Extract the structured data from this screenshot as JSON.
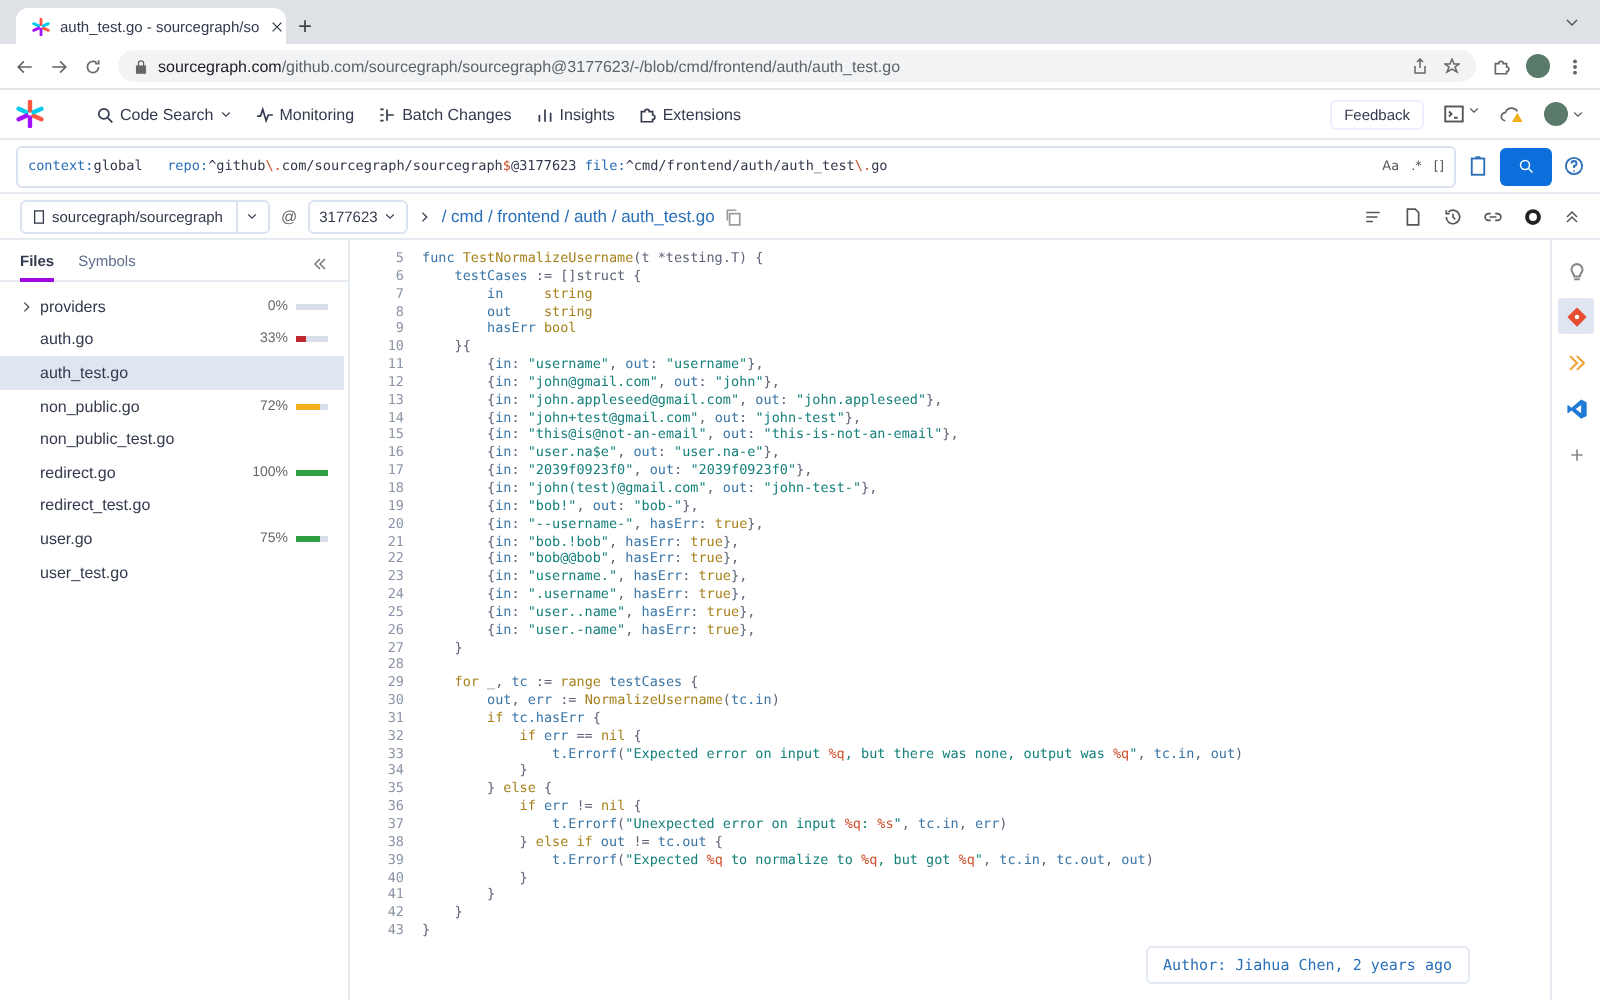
{
  "browser": {
    "tab_title": "auth_test.go - sourcegraph/so",
    "new_tab": "+",
    "url_host": "sourcegraph.com",
    "url_path": "/github.com/sourcegraph/sourcegraph@3177623/-/blob/cmd/frontend/auth/auth_test.go"
  },
  "nav": {
    "items": [
      {
        "label": "Code Search",
        "dropdown": true
      },
      {
        "label": "Monitoring",
        "dropdown": false
      },
      {
        "label": "Batch Changes",
        "dropdown": false
      },
      {
        "label": "Insights",
        "dropdown": false
      },
      {
        "label": "Extensions",
        "dropdown": false
      }
    ],
    "feedback": "Feedback"
  },
  "search": {
    "query": [
      {
        "kind": "filter",
        "text": "context:"
      },
      {
        "kind": "plain",
        "text": "global   "
      },
      {
        "kind": "filter",
        "text": "repo:"
      },
      {
        "kind": "plain",
        "text": "^github"
      },
      {
        "kind": "escape",
        "text": "\\."
      },
      {
        "kind": "plain",
        "text": "com/sourcegraph/sourcegraph"
      },
      {
        "kind": "escape",
        "text": "$"
      },
      {
        "kind": "plain",
        "text": "@3177623 "
      },
      {
        "kind": "filter",
        "text": "file:"
      },
      {
        "kind": "plain",
        "text": "^cmd/frontend/auth/auth_test"
      },
      {
        "kind": "escape",
        "text": "\\."
      },
      {
        "kind": "plain",
        "text": "go"
      }
    ],
    "toggles": [
      "Aa",
      ".*",
      "[]"
    ]
  },
  "breadcrumb": {
    "repo": "sourcegraph/sourcegraph",
    "at": "@",
    "revision": "3177623",
    "path": "/ cmd / frontend / auth / auth_test.go"
  },
  "sidebar": {
    "tabs": [
      {
        "label": "Files",
        "selected": true
      },
      {
        "label": "Symbols",
        "selected": false
      }
    ],
    "files": [
      {
        "kind": "folder",
        "name": "providers",
        "expanded": false,
        "coverage": "0%",
        "selected": false
      },
      {
        "kind": "file",
        "name": "auth.go",
        "coverage": "33%",
        "level": 0.33,
        "color": "#c0262d",
        "selected": false
      },
      {
        "kind": "file",
        "name": "auth_test.go",
        "selected": true
      },
      {
        "kind": "file",
        "name": "non_public.go",
        "coverage": "72%",
        "level": 0.72,
        "color": "#f2b01e",
        "selected": false
      },
      {
        "kind": "file",
        "name": "non_public_test.go",
        "selected": false
      },
      {
        "kind": "file",
        "name": "redirect.go",
        "coverage": "100%",
        "level": 1,
        "color": "#2ea043",
        "selected": false
      },
      {
        "kind": "file",
        "name": "redirect_test.go",
        "selected": false
      },
      {
        "kind": "file",
        "name": "user.go",
        "coverage": "75%",
        "level": 0.75,
        "color": "#2ea043",
        "selected": false
      },
      {
        "kind": "file",
        "name": "user_test.go",
        "selected": false
      }
    ]
  },
  "code": [
    {
      "number": "5",
      "segments": [
        {
          "kind": "var",
          "text": "func"
        },
        {
          "kind": "func",
          "text": " TestNormalizeUsername"
        },
        {
          "kind": "plain",
          "text": "(t *testing.T) {"
        }
      ]
    },
    {
      "number": "6",
      "segments": [
        {
          "kind": "var",
          "text": "    testCases"
        },
        {
          "kind": "plain",
          "text": " := []struct {"
        }
      ]
    },
    {
      "number": "7",
      "segments": [
        {
          "kind": "var",
          "text": "        in"
        },
        {
          "kind": "keyword",
          "text": "     string"
        }
      ]
    },
    {
      "number": "8",
      "segments": [
        {
          "kind": "var",
          "text": "        out"
        },
        {
          "kind": "keyword",
          "text": "    string"
        }
      ]
    },
    {
      "number": "9",
      "segments": [
        {
          "kind": "var",
          "text": "        hasErr"
        },
        {
          "kind": "keyword",
          "text": " bool"
        }
      ]
    },
    {
      "number": "10",
      "segments": [
        {
          "kind": "plain",
          "text": "    }{"
        }
      ]
    },
    {
      "number": "11",
      "segments": [
        {
          "kind": "plain",
          "text": "        {"
        },
        {
          "kind": "var",
          "text": "in"
        },
        {
          "kind": "plain",
          "text": ": "
        },
        {
          "kind": "string",
          "text": "\"username\""
        },
        {
          "kind": "plain",
          "text": ", "
        },
        {
          "kind": "var",
          "text": "out"
        },
        {
          "kind": "plain",
          "text": ": "
        },
        {
          "kind": "string",
          "text": "\"username\""
        },
        {
          "kind": "plain",
          "text": "},"
        }
      ]
    },
    {
      "number": "12",
      "segments": [
        {
          "kind": "plain",
          "text": "        {"
        },
        {
          "kind": "var",
          "text": "in"
        },
        {
          "kind": "plain",
          "text": ": "
        },
        {
          "kind": "string",
          "text": "\"john@gmail.com\""
        },
        {
          "kind": "plain",
          "text": ", "
        },
        {
          "kind": "var",
          "text": "out"
        },
        {
          "kind": "plain",
          "text": ": "
        },
        {
          "kind": "string",
          "text": "\"john\""
        },
        {
          "kind": "plain",
          "text": "},"
        }
      ]
    },
    {
      "number": "13",
      "segments": [
        {
          "kind": "plain",
          "text": "        {"
        },
        {
          "kind": "var",
          "text": "in"
        },
        {
          "kind": "plain",
          "text": ": "
        },
        {
          "kind": "string",
          "text": "\"john.appleseed@gmail.com\""
        },
        {
          "kind": "plain",
          "text": ", "
        },
        {
          "kind": "var",
          "text": "out"
        },
        {
          "kind": "plain",
          "text": ": "
        },
        {
          "kind": "string",
          "text": "\"john.appleseed\""
        },
        {
          "kind": "plain",
          "text": "},"
        }
      ]
    },
    {
      "number": "14",
      "segments": [
        {
          "kind": "plain",
          "text": "        {"
        },
        {
          "kind": "var",
          "text": "in"
        },
        {
          "kind": "plain",
          "text": ": "
        },
        {
          "kind": "string",
          "text": "\"john+test@gmail.com\""
        },
        {
          "kind": "plain",
          "text": ", "
        },
        {
          "kind": "var",
          "text": "out"
        },
        {
          "kind": "plain",
          "text": ": "
        },
        {
          "kind": "string",
          "text": "\"john-test\""
        },
        {
          "kind": "plain",
          "text": "},"
        }
      ]
    },
    {
      "number": "15",
      "segments": [
        {
          "kind": "plain",
          "text": "        {"
        },
        {
          "kind": "var",
          "text": "in"
        },
        {
          "kind": "plain",
          "text": ": "
        },
        {
          "kind": "string",
          "text": "\"this@is@not-an-email\""
        },
        {
          "kind": "plain",
          "text": ", "
        },
        {
          "kind": "var",
          "text": "out"
        },
        {
          "kind": "plain",
          "text": ": "
        },
        {
          "kind": "string",
          "text": "\"this-is-not-an-email\""
        },
        {
          "kind": "plain",
          "text": "},"
        }
      ]
    },
    {
      "number": "16",
      "segments": [
        {
          "kind": "plain",
          "text": "        {"
        },
        {
          "kind": "var",
          "text": "in"
        },
        {
          "kind": "plain",
          "text": ": "
        },
        {
          "kind": "string",
          "text": "\"user.na$e\""
        },
        {
          "kind": "plain",
          "text": ", "
        },
        {
          "kind": "var",
          "text": "out"
        },
        {
          "kind": "plain",
          "text": ": "
        },
        {
          "kind": "string",
          "text": "\"user.na-e\""
        },
        {
          "kind": "plain",
          "text": "},"
        }
      ]
    },
    {
      "number": "17",
      "segments": [
        {
          "kind": "plain",
          "text": "        {"
        },
        {
          "kind": "var",
          "text": "in"
        },
        {
          "kind": "plain",
          "text": ": "
        },
        {
          "kind": "string",
          "text": "\"2039f0923f0\""
        },
        {
          "kind": "plain",
          "text": ", "
        },
        {
          "kind": "var",
          "text": "out"
        },
        {
          "kind": "plain",
          "text": ": "
        },
        {
          "kind": "string",
          "text": "\"2039f0923f0\""
        },
        {
          "kind": "plain",
          "text": "},"
        }
      ]
    },
    {
      "number": "18",
      "segments": [
        {
          "kind": "plain",
          "text": "        {"
        },
        {
          "kind": "var",
          "text": "in"
        },
        {
          "kind": "plain",
          "text": ": "
        },
        {
          "kind": "string",
          "text": "\"john(test)@gmail.com\""
        },
        {
          "kind": "plain",
          "text": ", "
        },
        {
          "kind": "var",
          "text": "out"
        },
        {
          "kind": "plain",
          "text": ": "
        },
        {
          "kind": "string",
          "text": "\"john-test-\""
        },
        {
          "kind": "plain",
          "text": "},"
        }
      ]
    },
    {
      "number": "19",
      "segments": [
        {
          "kind": "plain",
          "text": "        {"
        },
        {
          "kind": "var",
          "text": "in"
        },
        {
          "kind": "plain",
          "text": ": "
        },
        {
          "kind": "string",
          "text": "\"bob!\""
        },
        {
          "kind": "plain",
          "text": ", "
        },
        {
          "kind": "var",
          "text": "out"
        },
        {
          "kind": "plain",
          "text": ": "
        },
        {
          "kind": "string",
          "text": "\"bob-\""
        },
        {
          "kind": "plain",
          "text": "},"
        }
      ]
    },
    {
      "number": "20",
      "segments": [
        {
          "kind": "plain",
          "text": "        {"
        },
        {
          "kind": "var",
          "text": "in"
        },
        {
          "kind": "plain",
          "text": ": "
        },
        {
          "kind": "string",
          "text": "\"--username-\""
        },
        {
          "kind": "plain",
          "text": ", "
        },
        {
          "kind": "var",
          "text": "hasErr"
        },
        {
          "kind": "plain",
          "text": ": "
        },
        {
          "kind": "keyword",
          "text": "true"
        },
        {
          "kind": "plain",
          "text": "},"
        }
      ]
    },
    {
      "number": "21",
      "segments": [
        {
          "kind": "plain",
          "text": "        {"
        },
        {
          "kind": "var",
          "text": "in"
        },
        {
          "kind": "plain",
          "text": ": "
        },
        {
          "kind": "string",
          "text": "\"bob.!bob\""
        },
        {
          "kind": "plain",
          "text": ", "
        },
        {
          "kind": "var",
          "text": "hasErr"
        },
        {
          "kind": "plain",
          "text": ": "
        },
        {
          "kind": "keyword",
          "text": "true"
        },
        {
          "kind": "plain",
          "text": "},"
        }
      ]
    },
    {
      "number": "22",
      "segments": [
        {
          "kind": "plain",
          "text": "        {"
        },
        {
          "kind": "var",
          "text": "in"
        },
        {
          "kind": "plain",
          "text": ": "
        },
        {
          "kind": "string",
          "text": "\"bob@@bob\""
        },
        {
          "kind": "plain",
          "text": ", "
        },
        {
          "kind": "var",
          "text": "hasErr"
        },
        {
          "kind": "plain",
          "text": ": "
        },
        {
          "kind": "keyword",
          "text": "true"
        },
        {
          "kind": "plain",
          "text": "},"
        }
      ]
    },
    {
      "number": "23",
      "segments": [
        {
          "kind": "plain",
          "text": "        {"
        },
        {
          "kind": "var",
          "text": "in"
        },
        {
          "kind": "plain",
          "text": ": "
        },
        {
          "kind": "string",
          "text": "\"username.\""
        },
        {
          "kind": "plain",
          "text": ", "
        },
        {
          "kind": "var",
          "text": "hasErr"
        },
        {
          "kind": "plain",
          "text": ": "
        },
        {
          "kind": "keyword",
          "text": "true"
        },
        {
          "kind": "plain",
          "text": "},"
        }
      ]
    },
    {
      "number": "24",
      "segments": [
        {
          "kind": "plain",
          "text": "        {"
        },
        {
          "kind": "var",
          "text": "in"
        },
        {
          "kind": "plain",
          "text": ": "
        },
        {
          "kind": "string",
          "text": "\".username\""
        },
        {
          "kind": "plain",
          "text": ", "
        },
        {
          "kind": "var",
          "text": "hasErr"
        },
        {
          "kind": "plain",
          "text": ": "
        },
        {
          "kind": "keyword",
          "text": "true"
        },
        {
          "kind": "plain",
          "text": "},"
        }
      ]
    },
    {
      "number": "25",
      "segments": [
        {
          "kind": "plain",
          "text": "        {"
        },
        {
          "kind": "var",
          "text": "in"
        },
        {
          "kind": "plain",
          "text": ": "
        },
        {
          "kind": "string",
          "text": "\"user..name\""
        },
        {
          "kind": "plain",
          "text": ", "
        },
        {
          "kind": "var",
          "text": "hasErr"
        },
        {
          "kind": "plain",
          "text": ": "
        },
        {
          "kind": "keyword",
          "text": "true"
        },
        {
          "kind": "plain",
          "text": "},"
        }
      ]
    },
    {
      "number": "26",
      "segments": [
        {
          "kind": "plain",
          "text": "        {"
        },
        {
          "kind": "var",
          "text": "in"
        },
        {
          "kind": "plain",
          "text": ": "
        },
        {
          "kind": "string",
          "text": "\"user.-name\""
        },
        {
          "kind": "plain",
          "text": ", "
        },
        {
          "kind": "var",
          "text": "hasErr"
        },
        {
          "kind": "plain",
          "text": ": "
        },
        {
          "kind": "keyword",
          "text": "true"
        },
        {
          "kind": "plain",
          "text": "},"
        }
      ]
    },
    {
      "number": "27",
      "segments": [
        {
          "kind": "plain",
          "text": "    }"
        }
      ]
    },
    {
      "number": "28"
    },
    {
      "number": "29",
      "segments": [
        {
          "kind": "keyword",
          "text": "    for"
        },
        {
          "kind": "plain",
          "text": " _, "
        },
        {
          "kind": "var",
          "text": "tc"
        },
        {
          "kind": "plain",
          "text": " := "
        },
        {
          "kind": "keyword",
          "text": "range"
        },
        {
          "kind": "var",
          "text": " testCases"
        },
        {
          "kind": "plain",
          "text": " {"
        }
      ]
    },
    {
      "number": "30",
      "segments": [
        {
          "kind": "var",
          "text": "        out"
        },
        {
          "kind": "plain",
          "text": ", "
        },
        {
          "kind": "var",
          "text": "err"
        },
        {
          "kind": "plain",
          "text": " := "
        },
        {
          "kind": "func",
          "text": "NormalizeUsername"
        },
        {
          "kind": "plain",
          "text": "("
        },
        {
          "kind": "var",
          "text": "tc.in"
        },
        {
          "kind": "plain",
          "text": ")"
        }
      ]
    },
    {
      "number": "31",
      "segments": [
        {
          "kind": "keyword",
          "text": "        if"
        },
        {
          "kind": "var",
          "text": " tc.hasErr"
        },
        {
          "kind": "plain",
          "text": " {"
        }
      ]
    },
    {
      "number": "32",
      "segments": [
        {
          "kind": "keyword",
          "text": "            if"
        },
        {
          "kind": "var",
          "text": " err"
        },
        {
          "kind": "plain",
          "text": " == "
        },
        {
          "kind": "keyword",
          "text": "nil"
        },
        {
          "kind": "plain",
          "text": " {"
        }
      ]
    },
    {
      "number": "33",
      "segments": [
        {
          "kind": "var",
          "text": "                t.Errorf"
        },
        {
          "kind": "plain",
          "text": "("
        },
        {
          "kind": "string",
          "text": "\"Expected error on input "
        },
        {
          "kind": "verb",
          "text": "%q"
        },
        {
          "kind": "string",
          "text": ", but there was none, output was "
        },
        {
          "kind": "verb",
          "text": "%q"
        },
        {
          "kind": "string",
          "text": "\""
        },
        {
          "kind": "plain",
          "text": ", "
        },
        {
          "kind": "var",
          "text": "tc.in"
        },
        {
          "kind": "plain",
          "text": ", "
        },
        {
          "kind": "var",
          "text": "out"
        },
        {
          "kind": "plain",
          "text": ")"
        }
      ]
    },
    {
      "number": "34",
      "segments": [
        {
          "kind": "plain",
          "text": "            }"
        }
      ]
    },
    {
      "number": "35",
      "segments": [
        {
          "kind": "plain",
          "text": "        } "
        },
        {
          "kind": "keyword",
          "text": "else"
        },
        {
          "kind": "plain",
          "text": " {"
        }
      ]
    },
    {
      "number": "36",
      "segments": [
        {
          "kind": "keyword",
          "text": "            if"
        },
        {
          "kind": "var",
          "text": " err"
        },
        {
          "kind": "plain",
          "text": " != "
        },
        {
          "kind": "keyword",
          "text": "nil"
        },
        {
          "kind": "plain",
          "text": " {"
        }
      ]
    },
    {
      "number": "37",
      "segments": [
        {
          "kind": "var",
          "text": "                t.Errorf"
        },
        {
          "kind": "plain",
          "text": "("
        },
        {
          "kind": "string",
          "text": "\"Unexpected error on input "
        },
        {
          "kind": "verb",
          "text": "%q"
        },
        {
          "kind": "string",
          "text": ": "
        },
        {
          "kind": "verb",
          "text": "%s"
        },
        {
          "kind": "string",
          "text": "\""
        },
        {
          "kind": "plain",
          "text": ", "
        },
        {
          "kind": "var",
          "text": "tc.in"
        },
        {
          "kind": "plain",
          "text": ", "
        },
        {
          "kind": "var",
          "text": "err"
        },
        {
          "kind": "plain",
          "text": ")"
        }
      ]
    },
    {
      "number": "38",
      "segments": [
        {
          "kind": "plain",
          "text": "            } "
        },
        {
          "kind": "keyword",
          "text": "else if"
        },
        {
          "kind": "var",
          "text": " out"
        },
        {
          "kind": "plain",
          "text": " != "
        },
        {
          "kind": "var",
          "text": "tc.out"
        },
        {
          "kind": "plain",
          "text": " {"
        }
      ]
    },
    {
      "number": "39",
      "segments": [
        {
          "kind": "var",
          "text": "                t.Errorf"
        },
        {
          "kind": "plain",
          "text": "("
        },
        {
          "kind": "string",
          "text": "\"Expected "
        },
        {
          "kind": "verb",
          "text": "%q"
        },
        {
          "kind": "string",
          "text": " to normalize to "
        },
        {
          "kind": "verb",
          "text": "%q"
        },
        {
          "kind": "string",
          "text": ", but got "
        },
        {
          "kind": "verb",
          "text": "%q"
        },
        {
          "kind": "string",
          "text": "\""
        },
        {
          "kind": "plain",
          "text": ", "
        },
        {
          "kind": "var",
          "text": "tc.in"
        },
        {
          "kind": "plain",
          "text": ", "
        },
        {
          "kind": "var",
          "text": "tc.out"
        },
        {
          "kind": "plain",
          "text": ", "
        },
        {
          "kind": "var",
          "text": "out"
        },
        {
          "kind": "plain",
          "text": ")"
        }
      ]
    },
    {
      "number": "40",
      "segments": [
        {
          "kind": "plain",
          "text": "            }"
        }
      ]
    },
    {
      "number": "41",
      "segments": [
        {
          "kind": "plain",
          "text": "        }"
        }
      ]
    },
    {
      "number": "42",
      "segments": [
        {
          "kind": "plain",
          "text": "    }"
        }
      ]
    },
    {
      "number": "43",
      "segments": [
        {
          "kind": "plain",
          "text": "}"
        }
      ]
    }
  ],
  "rail": [
    {
      "selected": false
    },
    {
      "selected": true
    },
    {
      "selected": false
    },
    {
      "selected": false
    },
    {
      "selected": false
    }
  ],
  "author": "Author: Jiahua Chen, 2 years ago"
}
